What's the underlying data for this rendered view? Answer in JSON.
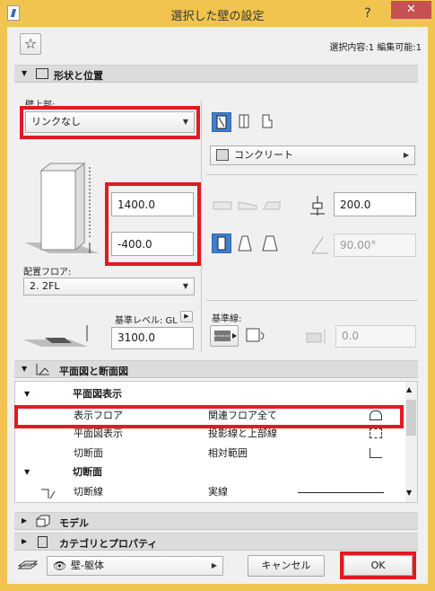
{
  "window": {
    "title": "選択した壁の設定",
    "help": "?",
    "close": "✕"
  },
  "top": {
    "selection_info": "選択内容:1 編集可能:1"
  },
  "shape_section": {
    "title": "形状と位置"
  },
  "top_link": {
    "label": "壁上部:",
    "value": "リンクなし"
  },
  "dims": {
    "height": "1400.0",
    "offset": "-400.0",
    "thickness": "200.0",
    "angle": "90.00°"
  },
  "floor": {
    "label": "配置フロア:",
    "value": "2. 2FL"
  },
  "ref_level": {
    "label": "基準レベル: GL",
    "value": "3100.0"
  },
  "material": {
    "value": "コンクリート"
  },
  "ref_line": {
    "label": "基準線:",
    "offset": "0.0"
  },
  "plan_section": {
    "title": "平面図と断面図"
  },
  "tree": {
    "group1": "平面図表示",
    "rows": [
      {
        "name": "表示フロア",
        "value": "関連フロア全て"
      },
      {
        "name": "平面図表示",
        "value": "投影線と上部線"
      },
      {
        "name": "切断面",
        "value": "相対範囲"
      }
    ],
    "group2": "切断面",
    "row4": {
      "name": "切断線",
      "value": "実線"
    }
  },
  "model_section": {
    "title": "モデル"
  },
  "category_section": {
    "title": "カテゴリとプロパティ"
  },
  "bottom": {
    "layer": "壁-躯体",
    "cancel": "キャンセル",
    "ok": "OK"
  }
}
